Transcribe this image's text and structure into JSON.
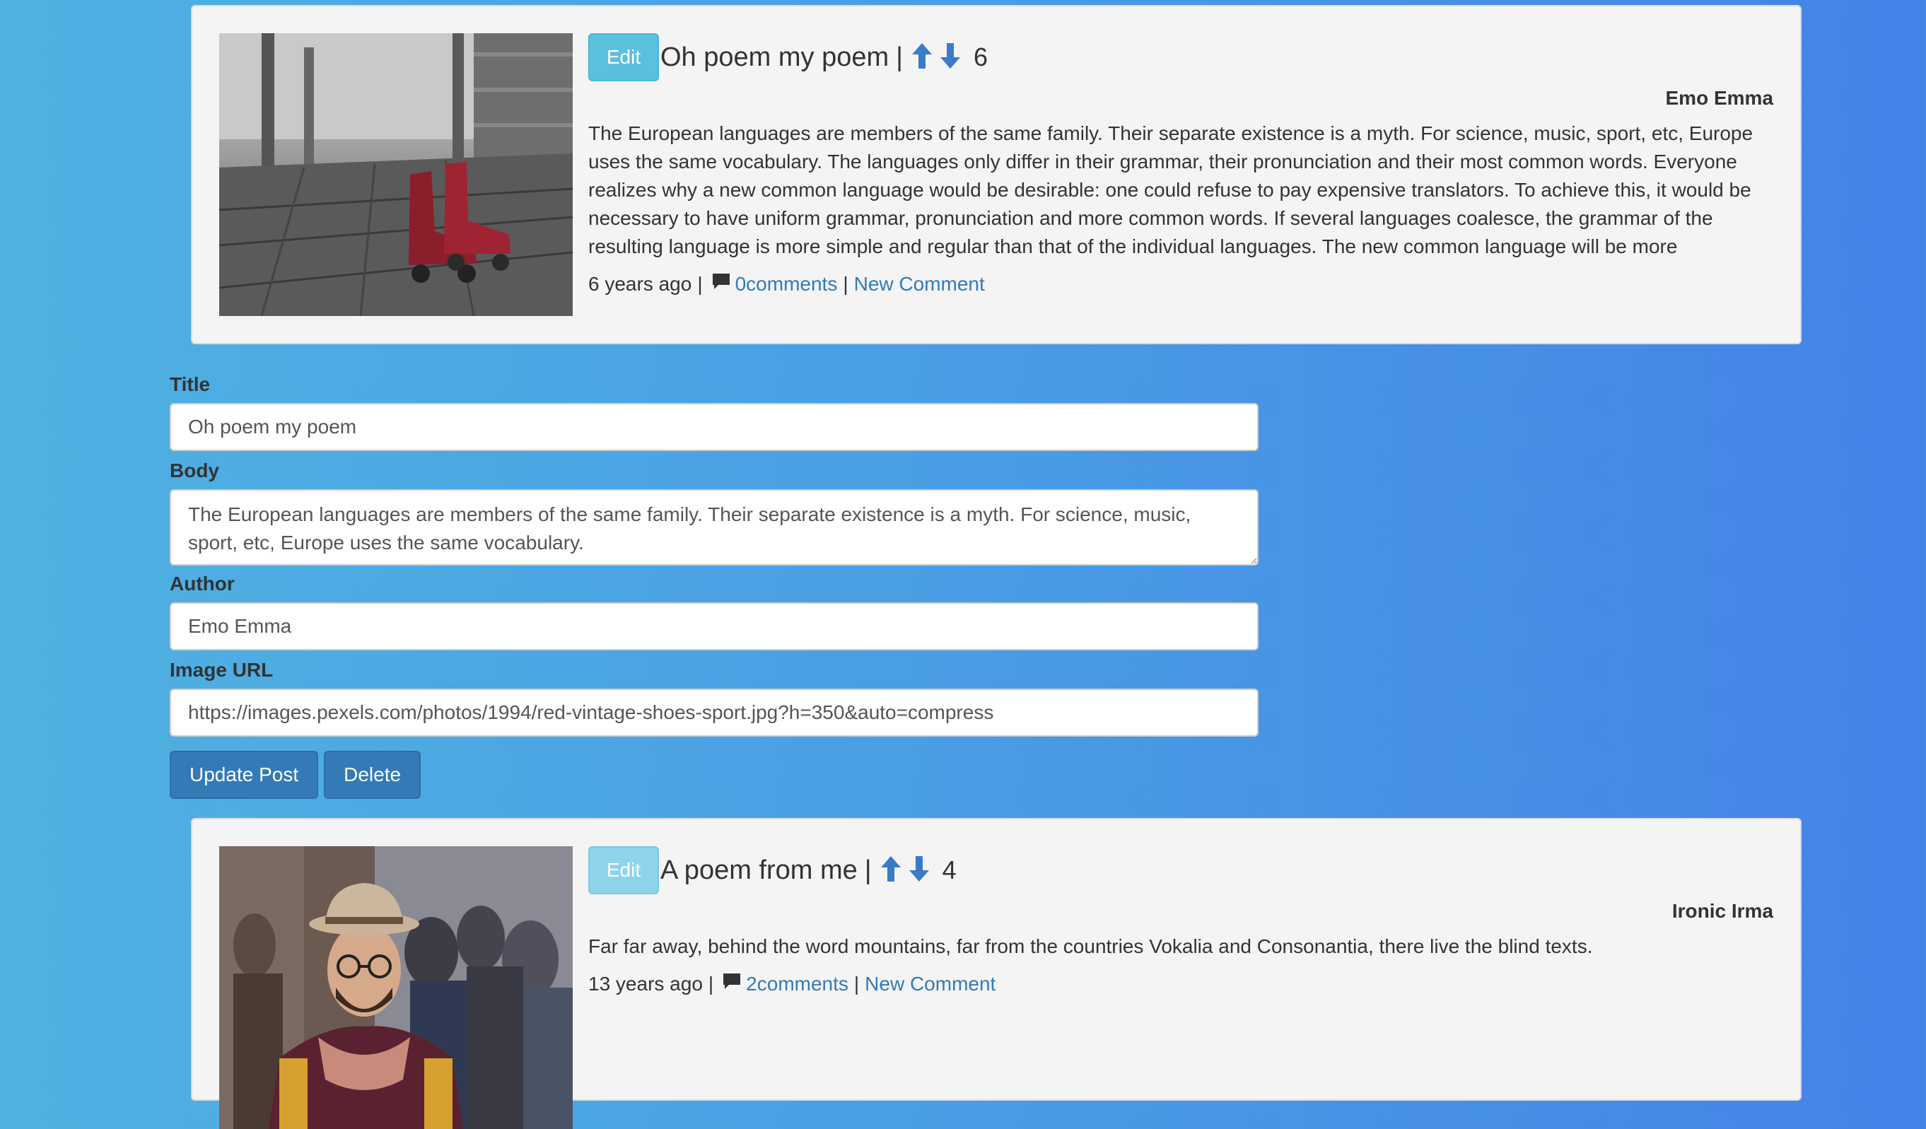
{
  "posts": [
    {
      "edit_label": "Edit",
      "title": "Oh poem my poem",
      "separator": "|",
      "votes": "6",
      "author": "Emo Emma",
      "body": "The European languages are members of the same family. Their separate existence is a myth. For science, music, sport, etc, Europe uses the same vocabulary. The languages only differ in their grammar, their pronunciation and their most common words. Everyone realizes why a new common language would be desirable: one could refuse to pay expensive translators. To achieve this, it would be necessary to have uniform grammar, pronunciation and more common words. If several languages coalesce, the grammar of the resulting language is more simple and regular than that of the individual languages. The new common language will be more",
      "time_ago": "6 years ago",
      "comments_link": "0comments",
      "new_comment_link": "New Comment",
      "image_icon": "roller-skates-image"
    },
    {
      "edit_label": "Edit",
      "title": "A poem from me",
      "separator": "|",
      "votes": "4",
      "author": "Ironic Irma",
      "body": "Far far away, behind the word mountains, far from the countries Vokalia and Consonantia, there live the blind texts.",
      "time_ago": "13 years ago",
      "comments_link": "2comments",
      "new_comment_link": "New Comment",
      "image_icon": "man-in-hat-image"
    }
  ],
  "edit_form": {
    "title_label": "Title",
    "title_value": "Oh poem my poem",
    "body_label": "Body",
    "body_value": "The European languages are members of the same family. Their separate existence is a myth. For science, music, sport, etc, Europe uses the same vocabulary.",
    "author_label": "Author",
    "author_value": "Emo Emma",
    "image_url_label": "Image URL",
    "image_url_value": "https://images.pexels.com/photos/1994/red-vintage-shoes-sport.jpg?h=350&auto=compress",
    "update_label": "Update Post",
    "delete_label": "Delete"
  },
  "colors": {
    "edit_button": "#5bc0de",
    "primary_button": "#337ab7",
    "link": "#337ab7",
    "arrow": "#3a7bc8"
  }
}
